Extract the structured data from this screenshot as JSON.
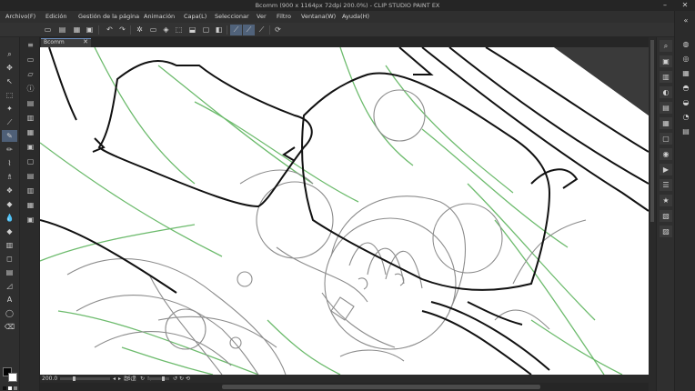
{
  "window": {
    "title": "Bcomm (900 x 1164px 72dpi 200.0%)  - CLIP STUDIO PAINT EX",
    "minimize": "–",
    "close": "✕"
  },
  "menu": [
    "Archivo(F)",
    "Edición",
    "Gestión de la página",
    "Animación",
    "Capa(L)",
    "Seleccionar",
    "Ver",
    "Filtro",
    "Ventana(W)",
    "Ayuda(H)"
  ],
  "command_icons": [
    "new-icon",
    "open-icon",
    "save-icon",
    "undo-icon",
    "redo-icon",
    "clear-icon",
    "fill-icon",
    "transform-icon",
    "snap-icon",
    "ruler-icon",
    "pen-ruler-icon",
    "record-icon",
    "layer-icon"
  ],
  "document_tab": {
    "label": "Bcomm",
    "close": "✕"
  },
  "status": {
    "zoom": "200.0",
    "rotation": "36.7",
    "angle_unit": "°"
  },
  "tools": [
    "zoom-icon",
    "move-icon",
    "operation-icon",
    "selection-icon",
    "auto-select-icon",
    "eyedropper-icon",
    "pen-icon",
    "pencil-icon",
    "brush-icon",
    "airbrush-icon",
    "decoration-icon",
    "eraser-icon",
    "blend-icon",
    "fill-icon",
    "gradient-icon",
    "figure-icon",
    "frame-icon",
    "ruler-icon",
    "text-icon",
    "balloon-icon",
    "correct-line-icon"
  ],
  "colors": {
    "accent": "#4e5f77",
    "sketch_green": "#6dbb6d",
    "line_black": "#111111",
    "line_gray": "#8c8c8c"
  }
}
